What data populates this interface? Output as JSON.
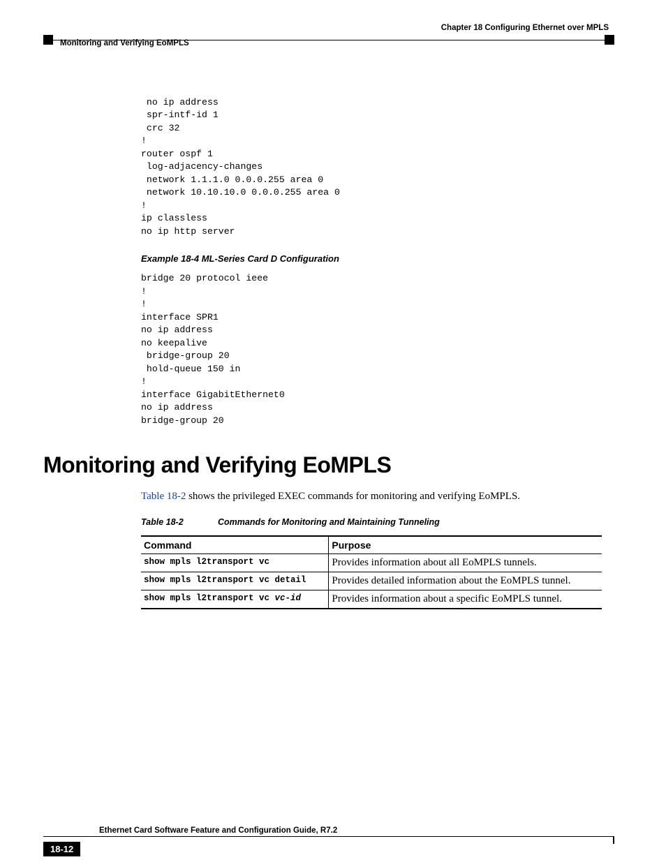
{
  "header": {
    "chapter_line": "Chapter 18    Configuring Ethernet over MPLS",
    "section_line": "Monitoring and Verifying EoMPLS"
  },
  "code_block_1": " no ip address\n spr-intf-id 1\n crc 32\n!\nrouter ospf 1\n log-adjacency-changes\n network 1.1.1.0 0.0.0.255 area 0\n network 10.10.10.0 0.0.0.255 area 0\n!\nip classless\nno ip http server",
  "example_title": "Example 18-4   ML-Series Card D Configuration",
  "code_block_2": "bridge 20 protocol ieee\n!\n!\ninterface SPR1\nno ip address\nno keepalive\n bridge-group 20\n hold-queue 150 in\n!\ninterface GigabitEthernet0\nno ip address\nbridge-group 20",
  "section_heading": "Monitoring and Verifying EoMPLS",
  "intro": {
    "link_text": "Table 18-2",
    "rest": " shows the privileged EXEC commands for monitoring and verifying EoMPLS."
  },
  "table": {
    "number": "Table 18-2",
    "title": "Commands for Monitoring and Maintaining Tunneling",
    "headers": {
      "c1": "Command",
      "c2": "Purpose"
    },
    "rows": [
      {
        "cmd": "show mpls l2transport vc",
        "var": "",
        "purpose": "Provides information about all EoMPLS tunnels."
      },
      {
        "cmd": "show mpls l2transport vc detail",
        "var": "",
        "purpose": "Provides detailed information about the EoMPLS tunnel."
      },
      {
        "cmd": "show mpls l2transport vc ",
        "var": "vc-id",
        "purpose": "Provides information about a specific EoMPLS tunnel."
      }
    ]
  },
  "footer": {
    "guide_title": "Ethernet Card Software Feature and Configuration Guide, R7.2",
    "page_number": "18-12"
  }
}
